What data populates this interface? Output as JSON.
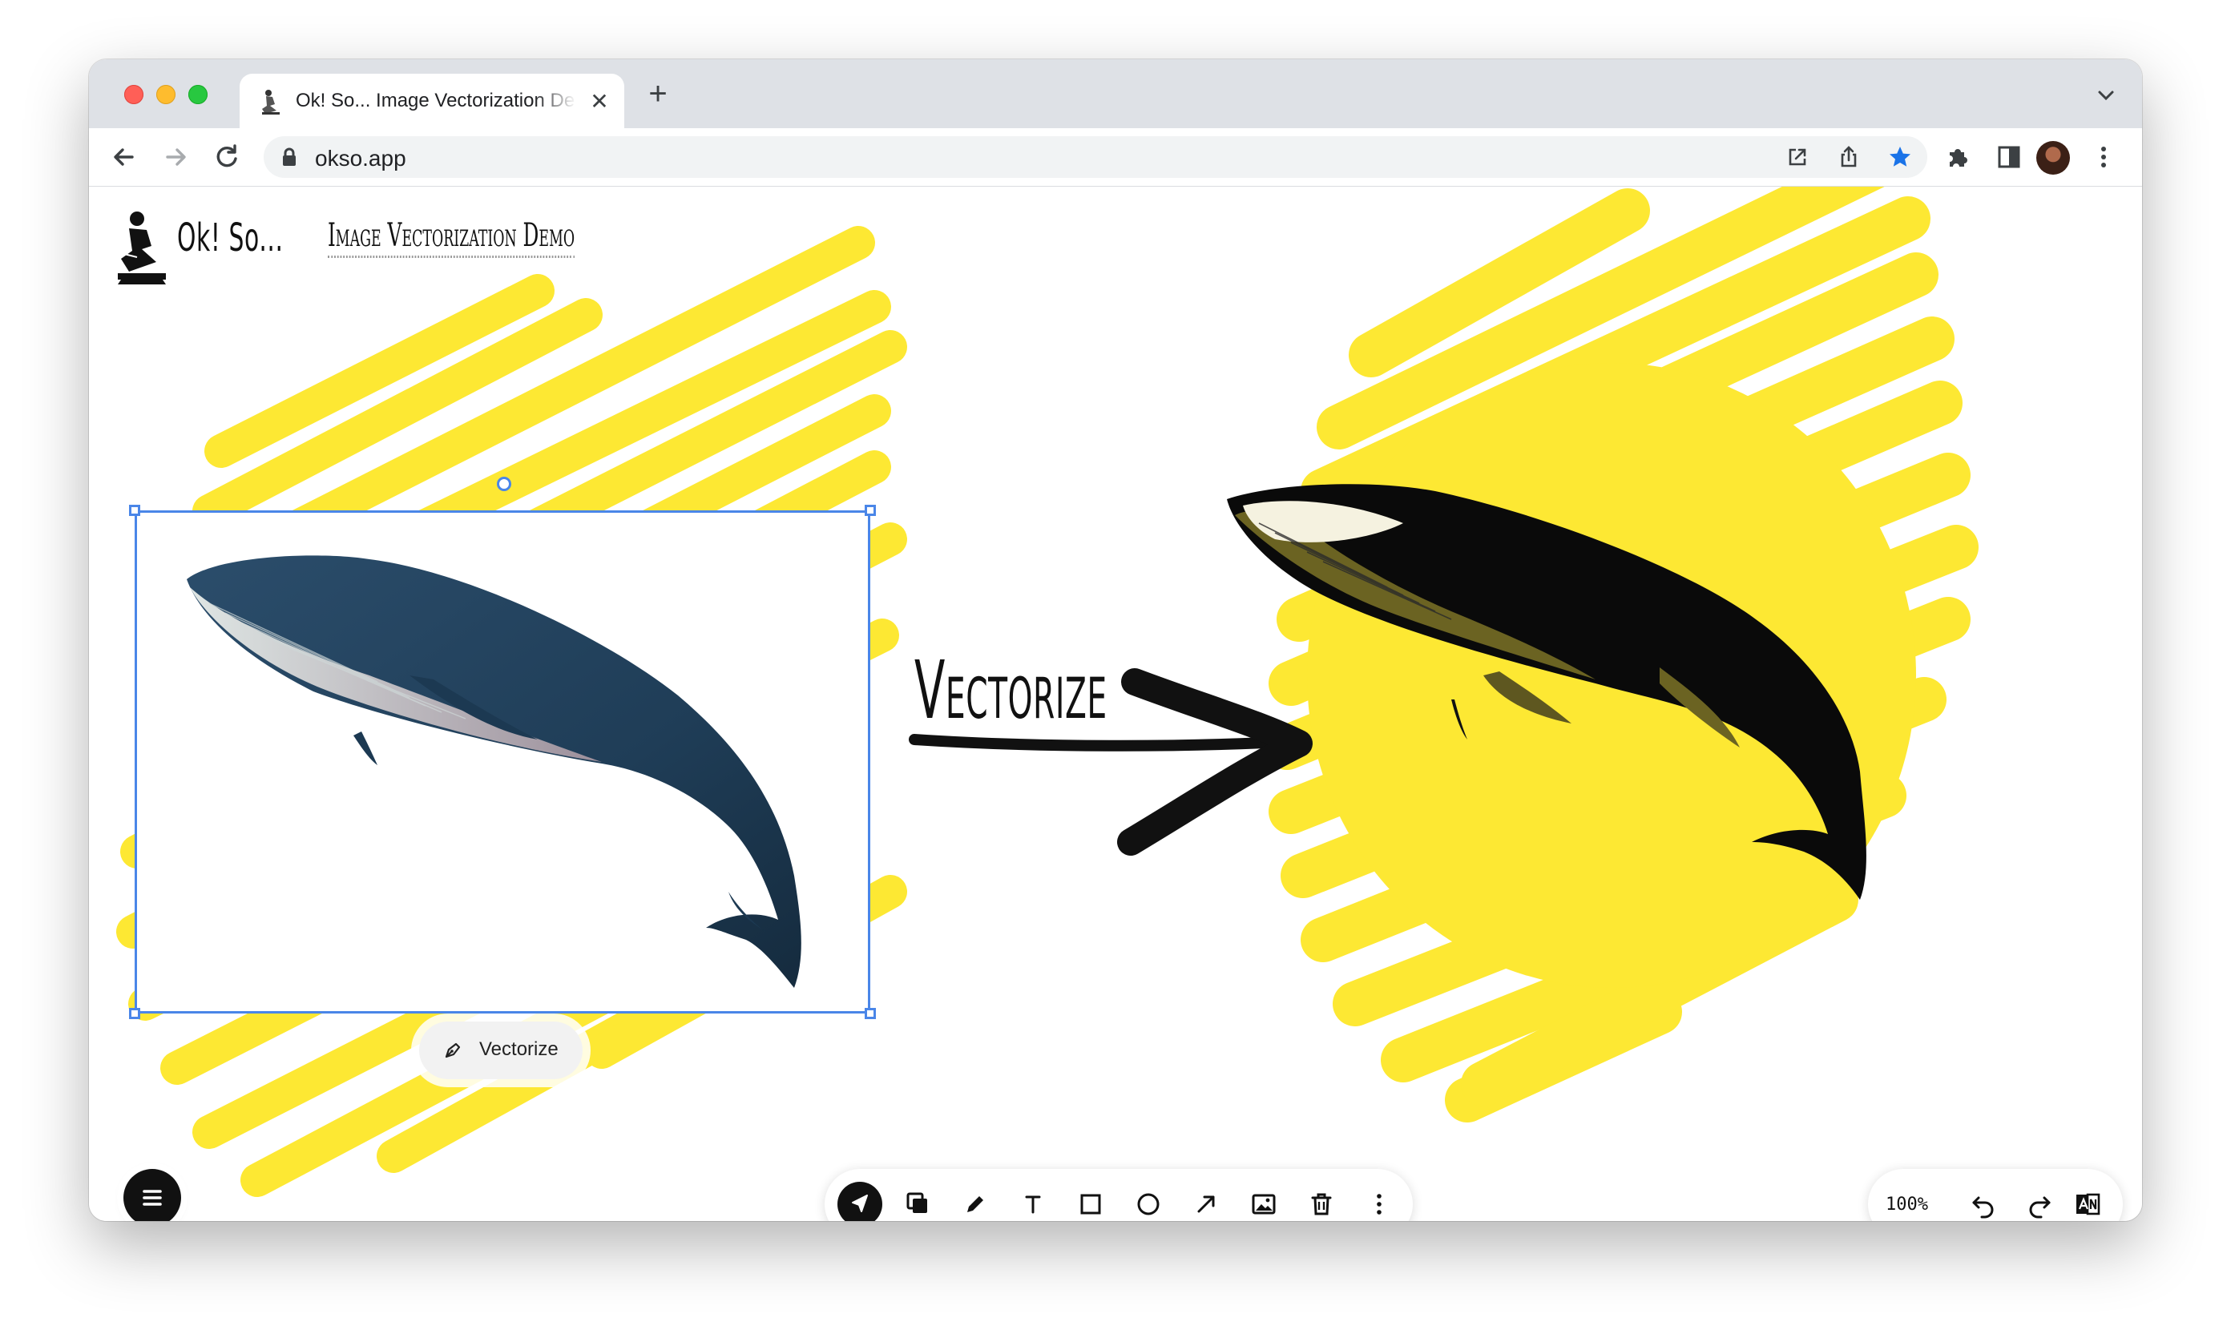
{
  "browser": {
    "tab_title": "Ok! So... Image Vectorization Demo",
    "tab_close": "✕",
    "new_tab": "+",
    "url": "okso.app"
  },
  "app": {
    "brand_name": "Ok! So...",
    "brand_subtitle": "Image Vectorization Demo"
  },
  "canvas": {
    "arrow_label": "Vectorize",
    "vectorize_button_label": "Vectorize"
  },
  "toolbar": {
    "tools": [
      "select-tool",
      "layers-tool",
      "pencil-tool",
      "text-tool",
      "rectangle-tool",
      "ellipse-tool",
      "arrow-tool",
      "image-tool",
      "delete-tool",
      "more-tool"
    ],
    "active_tool": "select-tool"
  },
  "zoom": {
    "level": "100%"
  },
  "colors": {
    "highlight_yellow": "#fde833",
    "selection_blue": "#4a86e8"
  }
}
